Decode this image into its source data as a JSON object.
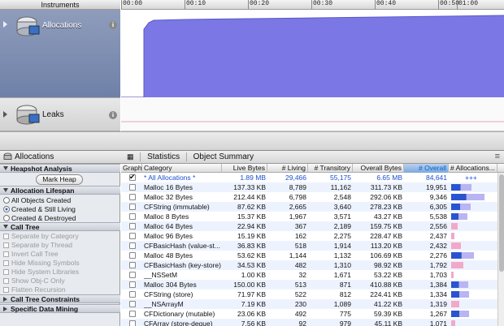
{
  "app": {
    "instruments_label": "Instruments"
  },
  "ruler": {
    "ticks": [
      "00:00",
      "00:10",
      "00:20",
      "00:30",
      "00:40",
      "00:50",
      "01:00"
    ]
  },
  "tracks": [
    {
      "name": "Allocations",
      "icon": "allocations-instrument-icon"
    },
    {
      "name": "Leaks",
      "icon": "leaks-instrument-icon"
    }
  ],
  "colors": {
    "accent": "#7b78e6",
    "selected_bar": "#2a53cf",
    "light_bar": "#b9b4f2",
    "pink_bar": "#f2a8c8"
  },
  "header": {
    "title": "Allocations",
    "tab_statistics": "Statistics",
    "tab_object_summary": "Object Summary"
  },
  "sidebar": {
    "heapshot_title": "Heapshot Analysis",
    "mark_heap": "Mark Heap",
    "lifespan_title": "Allocation Lifespan",
    "lifespan_options": [
      "All Objects Created",
      "Created & Still Living",
      "Created & Destroyed"
    ],
    "lifespan_selected": 1,
    "calltree_title": "Call Tree",
    "calltree_options": [
      "Separate by Category",
      "Separate by Thread",
      "Invert Call Tree",
      "Hide Missing Symbols",
      "Hide System Libraries",
      "Show Obj-C Only",
      "Flatten Recursion"
    ],
    "constraints_title": "Call Tree Constraints",
    "datamining_title": "Specific Data Mining"
  },
  "table": {
    "columns": [
      "Graph",
      "Category",
      "Live Bytes",
      "# Living",
      "# Transitory",
      "Overall Bytes",
      "# Overall",
      "# Allocations..."
    ],
    "sorted_column": 6,
    "summary_plus": "+++",
    "rows": [
      {
        "checked": true,
        "category": "* All Allocations *",
        "live_bytes": "1.89 MB",
        "living": "29,466",
        "transitory": "55,175",
        "overall_bytes": "6.65 MB",
        "overall": "84,641",
        "fraction": 1.0
      },
      {
        "checked": false,
        "category": "Malloc 16 Bytes",
        "live_bytes": "137.33 KB",
        "living": "8,789",
        "transitory": "11,162",
        "overall_bytes": "311.73 KB",
        "overall": "19,951",
        "fraction": 0.44
      },
      {
        "checked": false,
        "category": "Malloc 32 Bytes",
        "live_bytes": "212.44 KB",
        "living": "6,798",
        "transitory": "2,548",
        "overall_bytes": "292.06 KB",
        "overall": "9,346",
        "fraction": 0.73
      },
      {
        "checked": false,
        "category": "CFString (immutable)",
        "live_bytes": "87.62 KB",
        "living": "2,665",
        "transitory": "3,640",
        "overall_bytes": "278.23 KB",
        "overall": "6,305",
        "fraction": 0.42
      },
      {
        "checked": false,
        "category": "Malloc 8 Bytes",
        "live_bytes": "15.37 KB",
        "living": "1,967",
        "transitory": "3,571",
        "overall_bytes": "43.27 KB",
        "overall": "5,538",
        "fraction": 0.36
      },
      {
        "checked": false,
        "category": "Malloc 64 Bytes",
        "live_bytes": "22.94 KB",
        "living": "367",
        "transitory": "2,189",
        "overall_bytes": "159.75 KB",
        "overall": "2,556",
        "fraction": 0.14
      },
      {
        "checked": false,
        "category": "Malloc 96 Bytes",
        "live_bytes": "15.19 KB",
        "living": "162",
        "transitory": "2,275",
        "overall_bytes": "228.47 KB",
        "overall": "2,437",
        "fraction": 0.07
      },
      {
        "checked": false,
        "category": "CFBasicHash (value-st...",
        "live_bytes": "36.83 KB",
        "living": "518",
        "transitory": "1,914",
        "overall_bytes": "113.20 KB",
        "overall": "2,432",
        "fraction": 0.21
      },
      {
        "checked": false,
        "category": "Malloc 48 Bytes",
        "live_bytes": "53.62 KB",
        "living": "1,144",
        "transitory": "1,132",
        "overall_bytes": "106.69 KB",
        "overall": "2,276",
        "fraction": 0.5
      },
      {
        "checked": false,
        "category": "CFBasicHash (key-store)",
        "live_bytes": "34.53 KB",
        "living": "482",
        "transitory": "1,310",
        "overall_bytes": "98.92 KB",
        "overall": "1,792",
        "fraction": 0.27
      },
      {
        "checked": false,
        "category": "__NSSetM",
        "live_bytes": "1.00 KB",
        "living": "32",
        "transitory": "1,671",
        "overall_bytes": "53.22 KB",
        "overall": "1,703",
        "fraction": 0.02
      },
      {
        "checked": false,
        "category": "Malloc 304 Bytes",
        "live_bytes": "150.00 KB",
        "living": "513",
        "transitory": "871",
        "overall_bytes": "410.88 KB",
        "overall": "1,384",
        "fraction": 0.37
      },
      {
        "checked": false,
        "category": "CFString (store)",
        "live_bytes": "71.97 KB",
        "living": "522",
        "transitory": "812",
        "overall_bytes": "224.41 KB",
        "overall": "1,334",
        "fraction": 0.39
      },
      {
        "checked": false,
        "category": "__NSArrayM",
        "live_bytes": "7.19 KB",
        "living": "230",
        "transitory": "1,089",
        "overall_bytes": "41.22 KB",
        "overall": "1,319",
        "fraction": 0.17
      },
      {
        "checked": false,
        "category": "CFDictionary (mutable)",
        "live_bytes": "23.06 KB",
        "living": "492",
        "transitory": "775",
        "overall_bytes": "59.39 KB",
        "overall": "1,267",
        "fraction": 0.39
      },
      {
        "checked": false,
        "category": "CFArray (store-deque)",
        "live_bytes": "7.56 KB",
        "living": "92",
        "transitory": "979",
        "overall_bytes": "45.11 KB",
        "overall": "1,071",
        "fraction": 0.09
      }
    ]
  }
}
